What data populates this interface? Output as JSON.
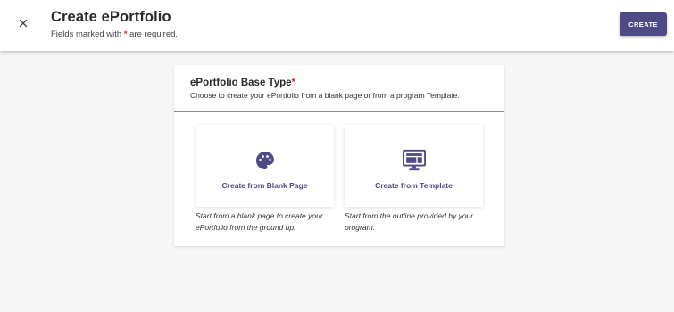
{
  "header": {
    "title": "Create ePortfolio",
    "subtitle_prefix": "Fields marked with ",
    "required_marker": "*",
    "subtitle_suffix": " are required.",
    "create_label": "CREATE"
  },
  "base_type": {
    "heading": "ePortfolio Base Type",
    "required_marker": "*",
    "description": "Choose to create your ePortfolio from a blank page or from a program Template.",
    "options": [
      {
        "label": "Create from Blank Page",
        "icon": "palette-icon",
        "help": "Start from a blank page to create your ePortfolio from the ground up."
      },
      {
        "label": "Create from Template",
        "icon": "monitor-template-icon",
        "help": "Start from the outline provided by your program."
      }
    ]
  },
  "colors": {
    "accent": "#4d4a86",
    "required": "#d0312d",
    "background": "#f7f7f8"
  }
}
